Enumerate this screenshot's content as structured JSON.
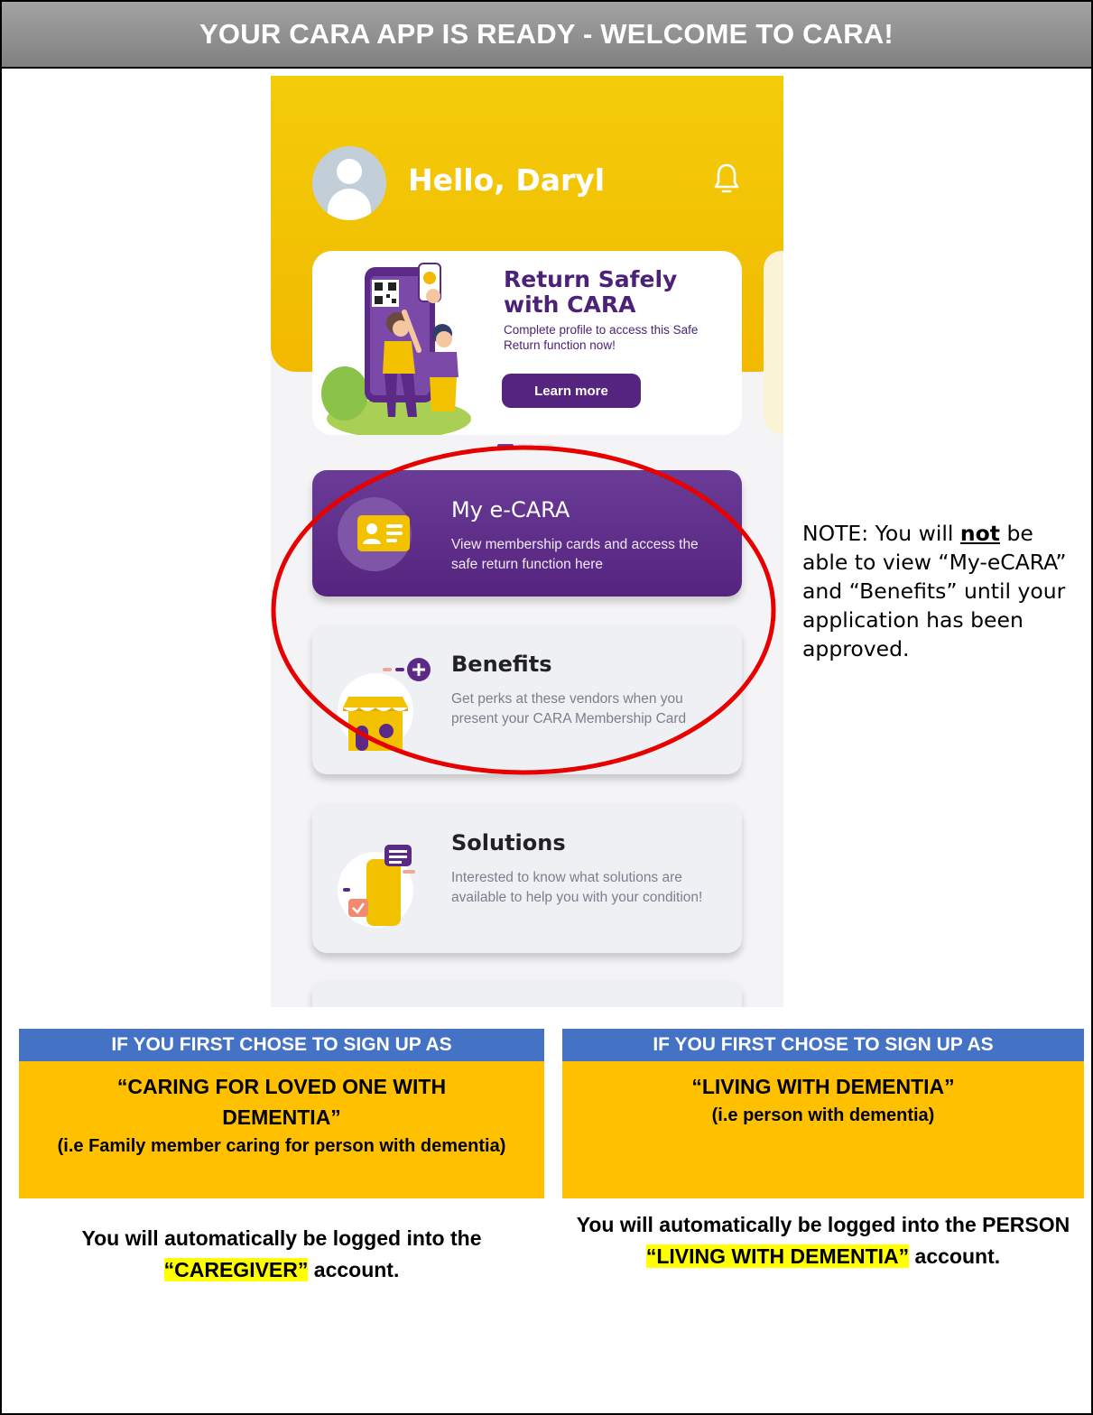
{
  "document": {
    "title": "YOUR CARA APP IS READY - WELCOME TO CARA!"
  },
  "phone": {
    "greeting": "Hello, Daryl",
    "promo": {
      "title": "Return Safely with CARA",
      "text": "Complete profile to access this Safe Return function now!",
      "button": "Learn more",
      "carousel_index": 1,
      "carousel_count": 3
    },
    "cards": [
      {
        "title": "My e-CARA",
        "text": "View membership cards and access the safe return function here",
        "icon": "id-card-icon"
      },
      {
        "title": "Benefits",
        "text": "Get perks at these vendors when you present your CARA Membership Card",
        "icon": "shop-icon"
      },
      {
        "title": "Solutions",
        "text": "Interested to know what solutions are available to help you with your condition!",
        "icon": "phone-chat-icon"
      }
    ]
  },
  "note": {
    "prefix": "NOTE: You will ",
    "emphasis": "not",
    "suffix": " be able to view “My-eCARA” and “Benefits” until your application has been approved."
  },
  "panels": {
    "left": {
      "heading": "IF YOU FIRST CHOSE TO SIGN UP AS",
      "option": "“CARING FOR LOVED ONE WITH DEMENTIA”",
      "clarification": "(i.e Family member caring for person with dementia)",
      "result_before": "You will automatically be logged into the ",
      "result_highlight": "“CAREGIVER”",
      "result_after": " account."
    },
    "right": {
      "heading": "IF YOU FIRST CHOSE TO SIGN UP AS",
      "option": "“LIVING WITH DEMENTIA”",
      "clarification": "(i.e person with dementia)",
      "result_before": "You will automatically be logged into the PERSON ",
      "result_highlight": "“LIVING WITH DEMENTIA”",
      "result_after": " account."
    }
  },
  "colors": {
    "title_bar": "#808080",
    "app_yellow": "#f2c200",
    "app_purple": "#55247e",
    "annotation_red": "#e60000",
    "panel_blue": "#4472c4",
    "panel_orange": "#ffc000",
    "highlight": "#ffff00"
  }
}
